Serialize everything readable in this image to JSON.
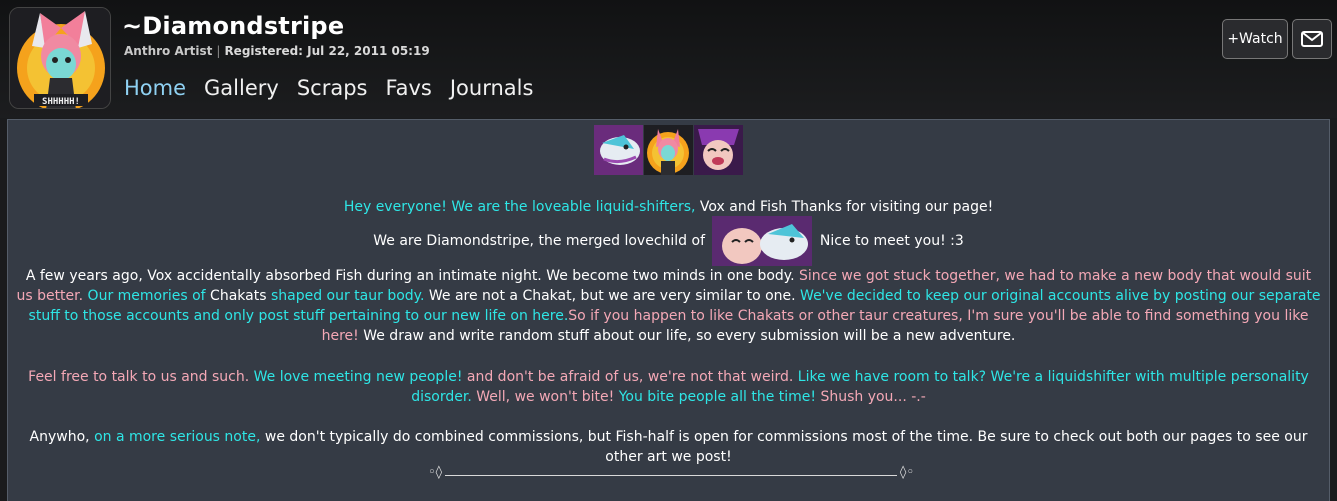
{
  "profile": {
    "username": "~Diamondstripe",
    "role": "Anthro Artist",
    "registered_label": "Registered:",
    "registered_value": "Jul 22, 2011 05:19",
    "avatar_caption": "SHHHHH!"
  },
  "nav": {
    "items": [
      "Home",
      "Gallery",
      "Scraps",
      "Favs",
      "Journals"
    ],
    "active": "Home"
  },
  "actions": {
    "watch_label": "+Watch",
    "note_icon": "envelope-icon"
  },
  "description": {
    "line1": [
      {
        "t": "Hey everyone! We are the loveable liquid-shifters, ",
        "c": "cy"
      },
      {
        "t": "Vox and Fish Thanks for visiting our page!",
        "c": "wh"
      }
    ],
    "line2_before": "We are Diamondstripe, the merged lovechild of ",
    "line2_after": " Nice to meet you! :3",
    "para1": [
      {
        "t": "A few years ago, Vox accidentally absorbed Fish during an intimate night. We become two minds in one body. ",
        "c": "wh"
      },
      {
        "t": "Since we got stuck together, we had to make a new body that would suit us better. ",
        "c": "pk"
      },
      {
        "t": "Our memories of ",
        "c": "cy"
      },
      {
        "t": "Chakats ",
        "c": "wh"
      },
      {
        "t": "shaped our taur body. ",
        "c": "cy"
      },
      {
        "t": "We are not a Chakat, but we are very similar to one. ",
        "c": "wh"
      },
      {
        "t": "We've decided to keep our original accounts alive by posting our separate stuff to those accounts and only post stuff pertaining to our new life on here.",
        "c": "cy"
      },
      {
        "t": "So if you happen to like Chakats or other taur creatures, I'm sure you'll be able to find something you like here! ",
        "c": "pk"
      },
      {
        "t": "We draw and write random stuff about our life, so every submission will be a new adventure.",
        "c": "wh"
      }
    ],
    "para2": [
      {
        "t": "Feel free to talk to us and such. ",
        "c": "pk"
      },
      {
        "t": "We love meeting new people! ",
        "c": "cy"
      },
      {
        "t": "and don't be afraid of us, we're not that weird. ",
        "c": "pk"
      },
      {
        "t": "Like we have room to talk? We're a liquidshifter with multiple personality disorder. ",
        "c": "cy"
      },
      {
        "t": "Well, we won't bite! ",
        "c": "pk"
      },
      {
        "t": "You bite people all the time! ",
        "c": "cy"
      },
      {
        "t": "Shush you... -.-",
        "c": "pk"
      }
    ],
    "para3": [
      {
        "t": "Anywho, ",
        "c": "wh"
      },
      {
        "t": "on a more serious note, ",
        "c": "cy"
      },
      {
        "t": "we don't typically do combined commissions, but Fish-half is open for commissions most of the time. Be sure to check out both our pages to see our other art we post!",
        "c": "wh"
      }
    ],
    "divider_left": "◦◊",
    "divider_right": "◊◦"
  },
  "colors": {
    "cyan": "#2ee6e6",
    "pink": "#f4a8b6",
    "nav_active": "#8fd1f2",
    "panel_bg": "#353b45"
  }
}
